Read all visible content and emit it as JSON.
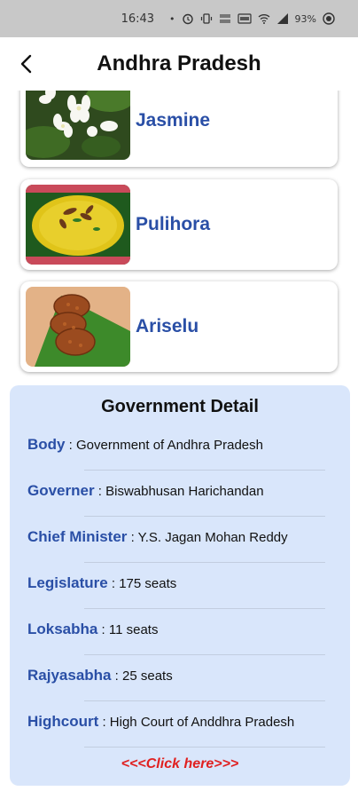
{
  "status_bar": {
    "time": "16:43",
    "dot": "•",
    "battery": "93%",
    "icons": [
      "alarm-icon",
      "vibrate-icon",
      "data-speed-icon",
      "volte-icon",
      "wifi-icon",
      "signal-icon",
      "battery-icon"
    ]
  },
  "header": {
    "title": "Andhra Pradesh",
    "back_icon": "back-arrow-icon"
  },
  "foods": [
    {
      "name": "Jasmine",
      "image": "jasmine-flowers"
    },
    {
      "name": "Pulihora",
      "image": "pulihora-rice"
    },
    {
      "name": "Ariselu",
      "image": "ariselu-sweets"
    }
  ],
  "government": {
    "title": "Government Detail",
    "rows": [
      {
        "label": "Body",
        "sep": " : ",
        "value": "Government of Andhra Pradesh"
      },
      {
        "label": "Governer",
        "sep": " : ",
        "value": "Biswabhusan Harichandan"
      },
      {
        "label": "Chief Minister",
        "sep": " : ",
        "value": "Y.S. Jagan Mohan Reddy"
      },
      {
        "label": "Legislature",
        "sep": " : ",
        "value": "175 seats"
      },
      {
        "label": "Loksabha",
        "sep": " : ",
        "value": "11 seats"
      },
      {
        "label": "Rajyasabha",
        "sep": " : ",
        "value": "25 seats"
      },
      {
        "label": "Highcourt",
        "sep": " : ",
        "value": "High Court of Anddhra Pradesh"
      }
    ],
    "link_text": "<<<Click here>>>"
  },
  "colors": {
    "accent_blue": "#2a4fa6",
    "panel_bg": "#d9e6fb",
    "link_red": "#e02020",
    "status_bg": "#c8c8c8"
  }
}
